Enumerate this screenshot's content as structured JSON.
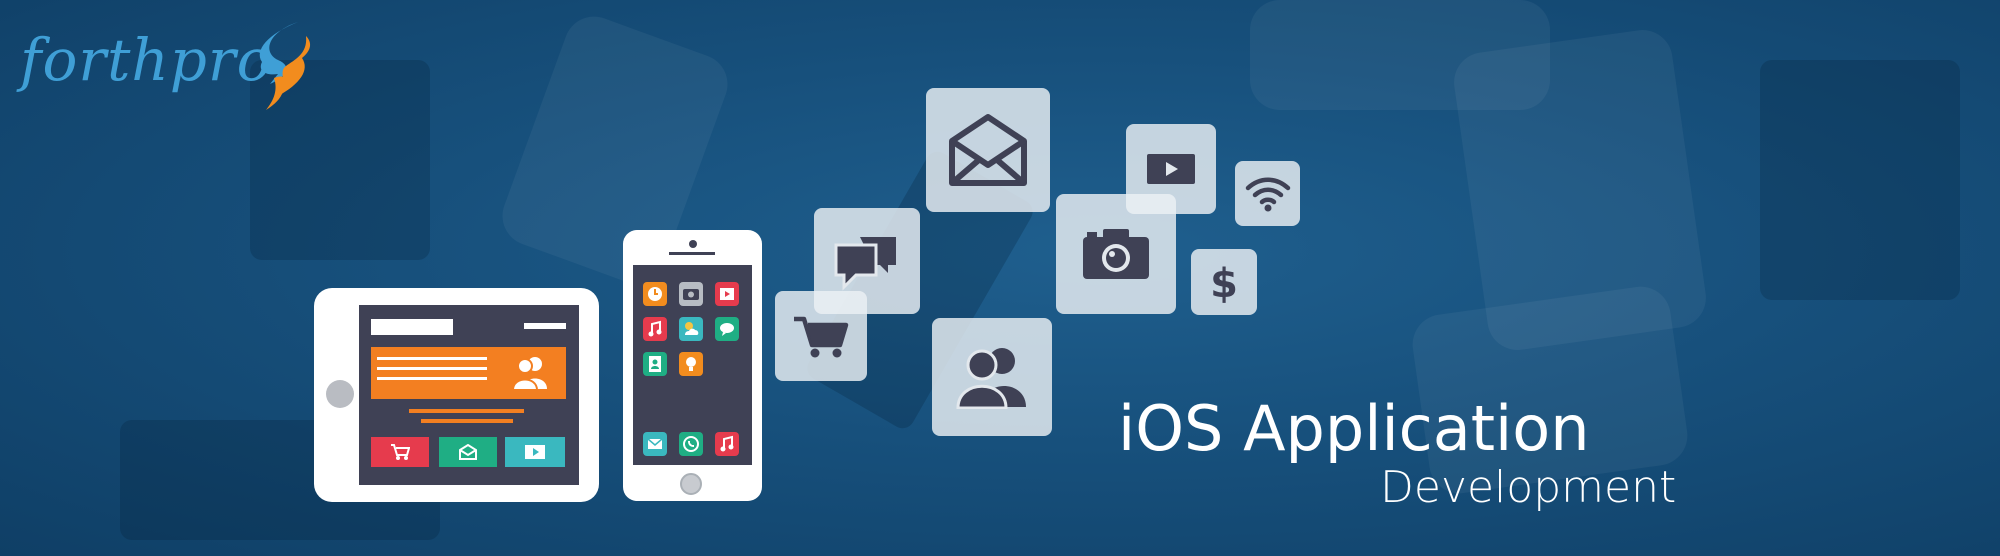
{
  "logo": {
    "text": "forthpro",
    "mark_icon": "s-swirl-logo"
  },
  "heading": {
    "title": "iOS Application",
    "subtitle": "Development"
  },
  "colors": {
    "background": "#17507c",
    "logo_blue": "#3f9fd6",
    "logo_orange": "#f28c1e",
    "tile": "#e3e8ed",
    "icon_dark": "#3f4155",
    "orange": "#f37f21",
    "red": "#e63b4d",
    "green": "#1fae84",
    "teal": "#3ab8bf"
  },
  "icons": [
    "envelope-icon",
    "video-play-icon",
    "wifi-icon",
    "chat-bubbles-icon",
    "camera-icon",
    "dollar-icon",
    "shopping-cart-icon",
    "users-icon"
  ],
  "devices": [
    "tablet",
    "phone"
  ]
}
